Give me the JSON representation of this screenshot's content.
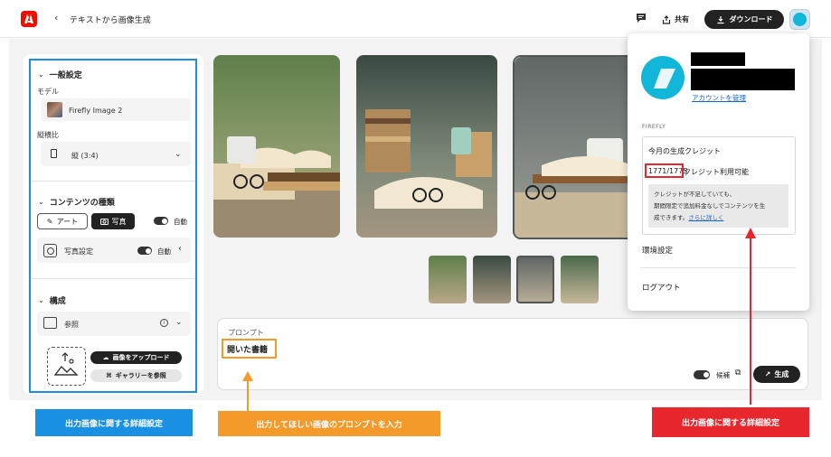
{
  "header": {
    "back_icon": "chevron-left-icon",
    "title": "テキストから画像生成",
    "share_label": "共有",
    "download_label": "ダウンロード"
  },
  "sidebar": {
    "general_title": "一般設定",
    "model_label": "モデル",
    "model_value": "Firefly Image 2",
    "ratio_label": "縦横比",
    "ratio_value": "縦 (3:4)",
    "content_title": "コンテンツの種類",
    "art_label": "アート",
    "photo_label": "写真",
    "auto_label": "自動",
    "photo_settings_label": "写真設定",
    "photo_settings_auto": "自動",
    "composition_title": "構成",
    "reference_label": "参照",
    "upload_label": "画像をアップロード",
    "gallery_label": "ギャラリーを参照"
  },
  "prompt": {
    "label": "プロンプト",
    "text": "開いた書籍",
    "candidates_label": "候補",
    "generate_label": "生成"
  },
  "account": {
    "manage_link": "アカウントを管理",
    "section_label": "FIREFLY",
    "credit_title": "今月の生成クレジット",
    "credit_count": "1771/1775",
    "credit_suffix": "クレジット利用可能",
    "note_line1": "クレジットが不足していても、",
    "note_line2": "期間限定で追加料金なしでコンテンツを生",
    "note_line3": "成できます。",
    "note_link": "さらに詳しく",
    "preferences_label": "環境設定",
    "logout_label": "ログアウト"
  },
  "annotations": {
    "left_label": "出力画像に関する詳細設定",
    "prompt_label": "出力してほしい画像のプロンプトを入力",
    "right_label": "出力画像に関する詳細設定"
  },
  "colors": {
    "adobe_red": "#eb1000",
    "annotation_blue": "#1a90e3",
    "annotation_orange": "#f39a2b",
    "annotation_red": "#e8262d",
    "avatar_cyan": "#12b6d8"
  }
}
